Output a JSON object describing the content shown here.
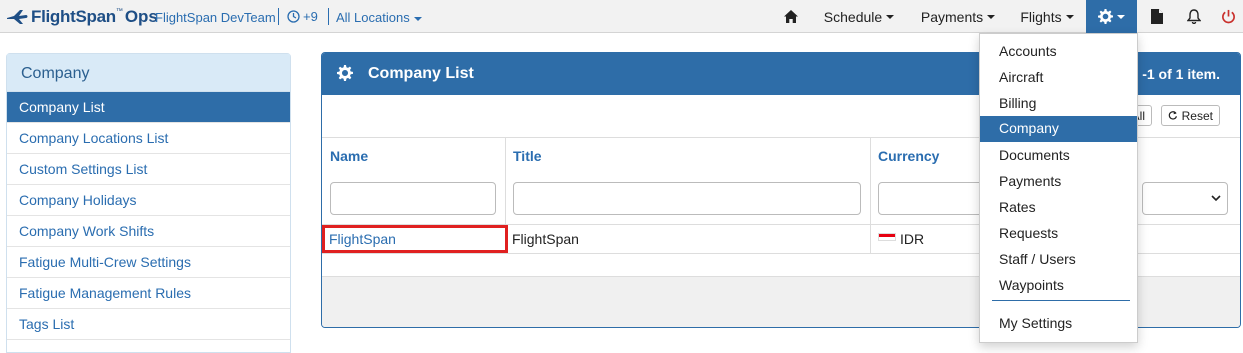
{
  "navbar": {
    "brand": "FlightSpan",
    "brand_tm": "™",
    "brand_suffix": "Ops",
    "team": "FlightSpan DevTeam",
    "timezone": "+9",
    "locations": "All Locations",
    "menu": [
      {
        "label": "Schedule",
        "icon": "caret-down"
      },
      {
        "label": "Payments",
        "icon": "caret-down"
      },
      {
        "label": "Flights",
        "icon": "caret-down"
      }
    ],
    "icons": [
      "home-icon",
      "gear-icon",
      "document-icon",
      "bell-icon",
      "power-icon"
    ],
    "accent": "#2e6da8"
  },
  "sidebar": {
    "title": "Company",
    "items": [
      {
        "label": "Company List",
        "active": true
      },
      {
        "label": "Company Locations List"
      },
      {
        "label": "Custom Settings List"
      },
      {
        "label": "Company Holidays"
      },
      {
        "label": "Company Work Shifts"
      },
      {
        "label": "Fatigue Multi-Crew Settings"
      },
      {
        "label": "Fatigue Management Rules"
      },
      {
        "label": "Tags List"
      }
    ]
  },
  "main": {
    "title": "Company List",
    "summary": "-1 of 1 item.",
    "partial_button": "All",
    "reset_label": "Reset",
    "columns": [
      {
        "label": "Name"
      },
      {
        "label": "Title"
      },
      {
        "label": "Currency"
      }
    ],
    "rows": [
      {
        "name": "FlightSpan",
        "title": "FlightSpan",
        "currency": "IDR",
        "flag_colors": [
          "#e70011",
          "#ffffff"
        ]
      }
    ],
    "highlight_color": "#e02020"
  },
  "settings_menu": {
    "items": [
      {
        "label": "Accounts"
      },
      {
        "label": "Aircraft"
      },
      {
        "label": "Billing"
      },
      {
        "label": "Company",
        "active": true
      },
      {
        "label": "Documents"
      },
      {
        "label": "Payments"
      },
      {
        "label": "Rates"
      },
      {
        "label": "Requests"
      },
      {
        "label": "Staff / Users"
      },
      {
        "label": "Waypoints"
      }
    ],
    "footer_item": "My Settings"
  }
}
